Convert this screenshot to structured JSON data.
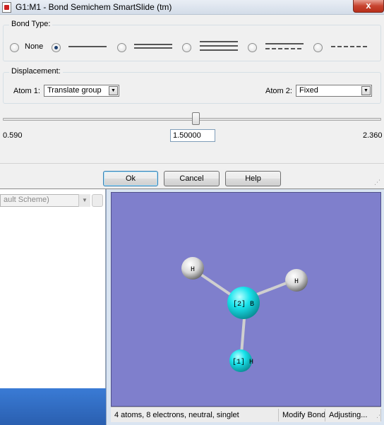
{
  "dialog": {
    "title": "G1:M1 - Bond Semichem SmartSlide (tm)",
    "close_glyph": "x",
    "bond_type": {
      "legend": "Bond Type:",
      "options": [
        {
          "label": "None",
          "style": "none",
          "checked": false
        },
        {
          "label": "",
          "style": "single",
          "checked": true
        },
        {
          "label": "",
          "style": "double",
          "checked": false
        },
        {
          "label": "",
          "style": "triple",
          "checked": false
        },
        {
          "label": "",
          "style": "aromatic",
          "checked": false
        },
        {
          "label": "",
          "style": "partial",
          "checked": false
        }
      ]
    },
    "displacement": {
      "legend": "Displacement:",
      "atom1_label": "Atom 1:",
      "atom1_value": "Translate group",
      "atom2_label": "Atom 2:",
      "atom2_value": "Fixed"
    },
    "slider": {
      "min_label": "0.590",
      "max_label": "2.360",
      "value": "1.50000",
      "fraction": 0.51
    },
    "buttons": {
      "ok": "Ok",
      "cancel": "Cancel",
      "help": "Help"
    }
  },
  "background": {
    "combo_text": "ault Scheme)"
  },
  "viewer": {
    "atoms": [
      {
        "label": "H",
        "color": "#f4f4f4",
        "kind": "hydrogen"
      },
      {
        "label": "H",
        "color": "#f4f4f4",
        "kind": "hydrogen"
      },
      {
        "label": "[2] B",
        "color": "#19e3ec",
        "kind": "boron"
      },
      {
        "label": "[1] H",
        "color": "#19e3ec",
        "kind": "hydrogen-selected"
      }
    ],
    "background_color": "#7f7fcc",
    "status": {
      "main": "4 atoms, 8 electrons, neutral, singlet",
      "mode": "Modify Bond",
      "state": "Adjusting..."
    }
  }
}
